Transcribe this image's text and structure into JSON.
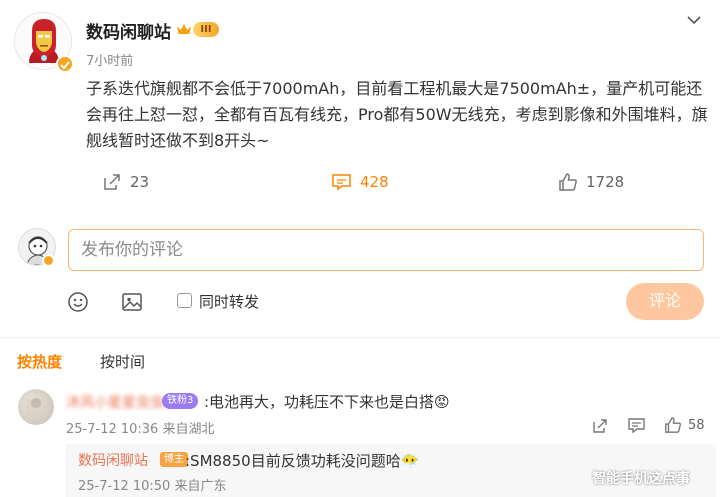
{
  "post": {
    "author": "数码闲聊站",
    "level_badge": "III",
    "time": "7小时前",
    "text": "子系迭代旗舰都不会低于7000mAh，目前看工程机最大是7500mAh±，量产机可能还会再往上怼一怼，全都有百瓦有线充，Pro都有50W无线充，考虑到影像和外围堆料，旗舰线暂时还做不到8开头~",
    "reposts": "23",
    "comments": "428",
    "likes": "1728"
  },
  "composer": {
    "placeholder": "发布你的评论",
    "repost_label": "同时转发",
    "submit_label": "评论"
  },
  "sort_tabs": {
    "hot": "按热度",
    "time": "按时间"
  },
  "comment": {
    "user": "沐风小星星虫虫",
    "fan_badge": "铁粉3",
    "text": ":电池再大，功耗压不下来也是白搭😡",
    "meta": "25-7-12 10:36 来自湖北",
    "likes": "58"
  },
  "reply": {
    "user": "数码闲聊站",
    "tag": "博主",
    "text": ":SM8850目前反馈功耗没问题哈😶‍🌫️",
    "meta": "25-7-12 10:50 来自广东"
  },
  "watermark": "智能手机这点事",
  "colors": {
    "accent": "#ff8200",
    "username": "#eb7350",
    "submit_disabled": "#ffc79f"
  },
  "icons": [
    "ironman-avatar",
    "verified-badge",
    "crown-icon",
    "chevron-down-icon",
    "repost-icon",
    "comment-icon",
    "like-icon",
    "emoji-icon",
    "image-icon",
    "share-icon"
  ]
}
